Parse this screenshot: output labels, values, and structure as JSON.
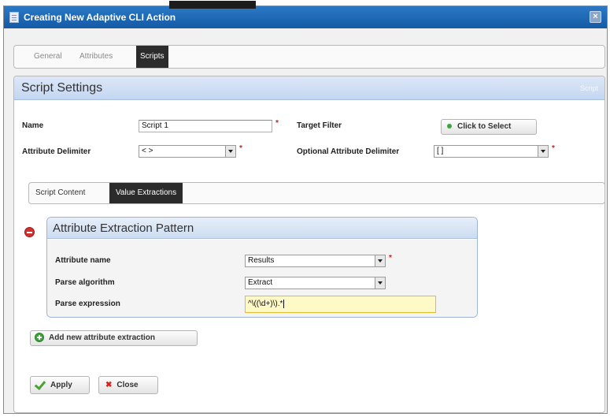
{
  "window": {
    "title": "Creating New Adaptive CLI Action",
    "close_label": "×"
  },
  "tabs": [
    {
      "label": "General"
    },
    {
      "label": "Attributes"
    },
    {
      "label": "Scripts"
    }
  ],
  "active_tab": "Scripts",
  "script_settings": {
    "title": "Script Settings",
    "header_right": "Script",
    "name_label": "Name",
    "name_value": "Script 1",
    "target_filter_label": "Target Filter",
    "click_to_select_label": "Click to Select",
    "attribute_delimiter_label": "Attribute Delimiter",
    "attribute_delimiter_value": "< >",
    "optional_attribute_delimiter_label": "Optional Attribute Delimiter",
    "optional_attribute_delimiter_value": "[ ]",
    "required_marker": "*"
  },
  "subtabs": [
    {
      "label": "Script Content"
    },
    {
      "label": "Value Extractions"
    }
  ],
  "active_subtab": "Value Extractions",
  "extraction": {
    "title": "Attribute Extraction Pattern",
    "attribute_name_label": "Attribute name",
    "attribute_name_value": "Results",
    "parse_algorithm_label": "Parse algorithm",
    "parse_algorithm_value": "Extract",
    "parse_expression_label": "Parse expression",
    "parse_expression_value": "^\\((\\d+)\\).*"
  },
  "add_extraction_label": "Add new attribute extraction",
  "footer": {
    "apply_label": "Apply",
    "close_label": "Close"
  },
  "colors": {
    "titlebar": "#1f69b8",
    "accent_green": "#3ea43e",
    "required_red": "#d42020",
    "highlight_field": "#fff9c8"
  }
}
